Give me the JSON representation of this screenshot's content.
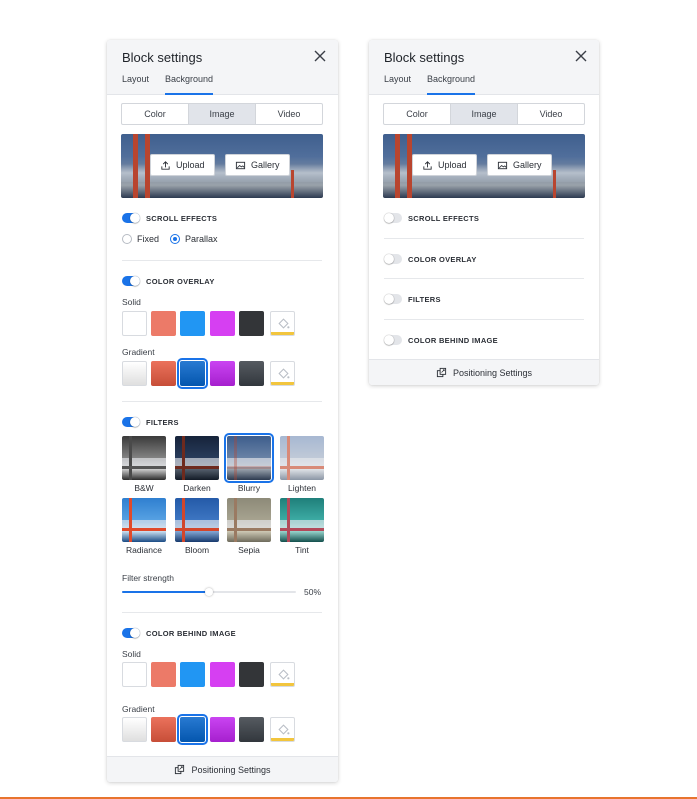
{
  "panel_left": {
    "title": "Block settings",
    "tabs": [
      {
        "label": "Layout",
        "active": false
      },
      {
        "label": "Background",
        "active": true
      }
    ],
    "media_tabs": [
      {
        "label": "Color",
        "active": false
      },
      {
        "label": "Image",
        "active": true
      },
      {
        "label": "Video",
        "active": false
      }
    ],
    "preview": {
      "upload_label": "Upload",
      "gallery_label": "Gallery"
    },
    "scroll_effects": {
      "label": "SCROLL EFFECTS",
      "enabled": true,
      "options": [
        {
          "label": "Fixed",
          "checked": false
        },
        {
          "label": "Parallax",
          "checked": true
        }
      ]
    },
    "color_overlay": {
      "label": "COLOR OVERLAY",
      "enabled": true,
      "solid_label": "Solid",
      "gradient_label": "Gradient",
      "solid_colors": [
        "#ffffff",
        "#ec7a68",
        "#2196f3",
        "#d63ff2",
        "#333538"
      ],
      "gradient_colors": [
        "#f1f1f1",
        "#d9604a",
        "#1668c0",
        "#b832e0",
        "#44494f"
      ],
      "gradient_selected_index": 2
    },
    "filters": {
      "label": "FILTERS",
      "enabled": true,
      "items": [
        {
          "name": "B&W",
          "selected": false
        },
        {
          "name": "Darken",
          "selected": false
        },
        {
          "name": "Blurry",
          "selected": true
        },
        {
          "name": "Lighten",
          "selected": false
        },
        {
          "name": "Radiance",
          "selected": false
        },
        {
          "name": "Bloom",
          "selected": false
        },
        {
          "name": "Sepia",
          "selected": false
        },
        {
          "name": "Tint",
          "selected": false
        }
      ],
      "strength_label": "Filter strength",
      "strength_value": "50%",
      "strength_fraction": 0.5
    },
    "color_behind_image": {
      "label": "COLOR BEHIND IMAGE",
      "enabled": true,
      "solid_label": "Solid",
      "gradient_label": "Gradient",
      "solid_colors": [
        "#ffffff",
        "#ec7a68",
        "#2196f3",
        "#d63ff2",
        "#333538"
      ],
      "gradient_colors": [
        "#f1f1f1",
        "#d9604a",
        "#1668c0",
        "#b832e0",
        "#44494f"
      ],
      "gradient_selected_index": 2
    },
    "footer_label": "Positioning Settings"
  },
  "panel_right": {
    "title": "Block settings",
    "tabs": [
      {
        "label": "Layout",
        "active": false
      },
      {
        "label": "Background",
        "active": true
      }
    ],
    "media_tabs": [
      {
        "label": "Color",
        "active": false
      },
      {
        "label": "Image",
        "active": true
      },
      {
        "label": "Video",
        "active": false
      }
    ],
    "preview": {
      "upload_label": "Upload",
      "gallery_label": "Gallery"
    },
    "sections": [
      {
        "label": "SCROLL EFFECTS",
        "enabled": false
      },
      {
        "label": "COLOR OVERLAY",
        "enabled": false
      },
      {
        "label": "FILTERS",
        "enabled": false
      },
      {
        "label": "COLOR BEHIND IMAGE",
        "enabled": false
      }
    ],
    "footer_label": "Positioning Settings"
  },
  "colors": {
    "accent": "#1a73e8",
    "header_bg": "#f4f5f7",
    "custom_swatch_strip": "#f2c53d"
  },
  "icons": {
    "close": "close-icon",
    "upload": "upload-icon",
    "gallery": "gallery-icon",
    "custom_color": "paint-bucket-icon",
    "positioning": "positioning-icon"
  }
}
